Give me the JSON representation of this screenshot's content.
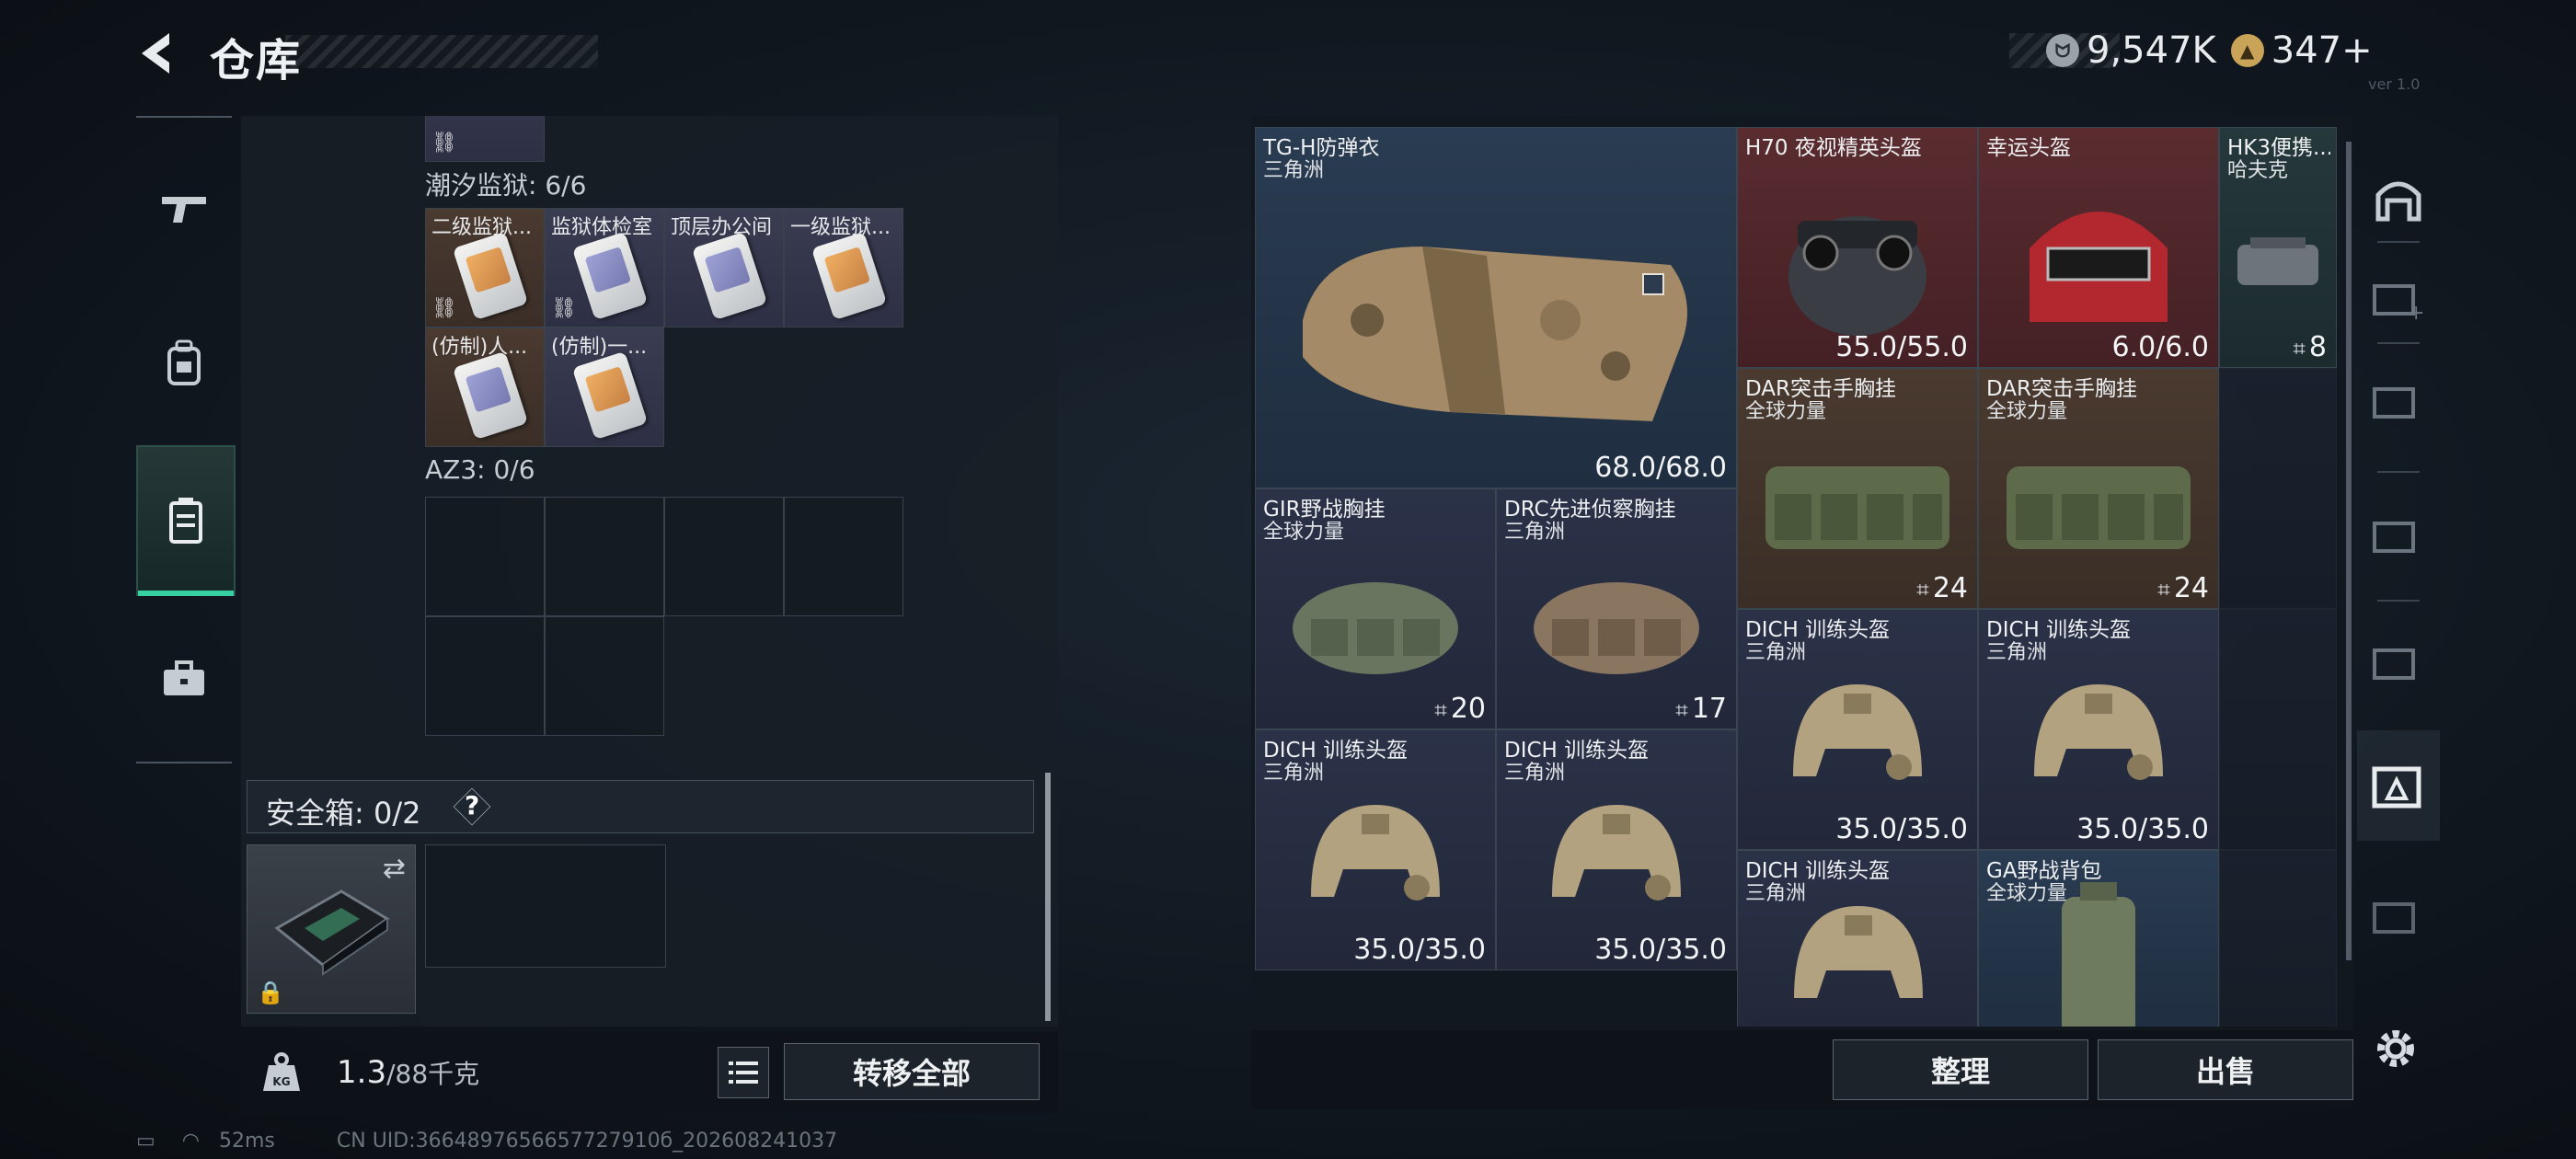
{
  "header": {
    "title": "仓库",
    "currency": [
      {
        "icon": "silver-coin-icon",
        "value": "9,547K"
      },
      {
        "icon": "gold-triangle-coin-icon",
        "value": "347+"
      }
    ],
    "version_text": "ver 1.0"
  },
  "left_nav": {
    "items": [
      {
        "icon": "gun-icon",
        "active": false
      },
      {
        "icon": "backpack-icon",
        "active": false
      },
      {
        "icon": "storage-case-icon",
        "active": true
      },
      {
        "icon": "briefcase-icon",
        "active": false
      }
    ]
  },
  "backpack": {
    "groups": [
      {
        "title": "潮汐监狱: 6/6",
        "items": [
          "二级监狱...",
          "监狱体检室",
          "顶层办公间",
          "一级监狱...",
          "(仿制)人...",
          "(仿制)一..."
        ]
      },
      {
        "title": "AZ3: 0/6"
      }
    ],
    "safe_box": {
      "label": "安全箱: 0/2",
      "help": "?"
    },
    "weight": {
      "current": "1.3",
      "max": "/88千克"
    },
    "transfer_all": "转移全部"
  },
  "stash": {
    "items": [
      {
        "name": "TG-H防弹衣",
        "brand": "三角洲",
        "value": "68.0/68.0",
        "color": "blue"
      },
      {
        "name": "H70 夜视精英头盔",
        "brand": "",
        "value": "55.0/55.0",
        "color": "red"
      },
      {
        "name": "幸运头盔",
        "brand": "",
        "value": "6.0/6.0",
        "color": "red"
      },
      {
        "name": "HK3便携...",
        "brand": "哈夫克",
        "value": "8",
        "color": "teal"
      },
      {
        "name": "DAR突击手胸挂",
        "brand": "全球力量",
        "value": "24",
        "color": "brown"
      },
      {
        "name": "DAR突击手胸挂",
        "brand": "全球力量",
        "value": "24",
        "color": "brown"
      },
      {
        "name": "GIR野战胸挂",
        "brand": "全球力量",
        "value": "20",
        "color": "slate"
      },
      {
        "name": "DRC先进侦察胸挂",
        "brand": "三角洲",
        "value": "17",
        "color": "slate"
      },
      {
        "name": "DICH 训练头盔",
        "brand": "三角洲",
        "value": "35.0/35.0",
        "color": "slate"
      },
      {
        "name": "DICH 训练头盔",
        "brand": "三角洲",
        "value": "35.0/35.0",
        "color": "slate"
      },
      {
        "name": "DICH 训练头盔",
        "brand": "三角洲",
        "value": "35.0/35.0",
        "color": "slate"
      },
      {
        "name": "DICH 训练头盔",
        "brand": "三角洲",
        "value": "35.0/35.0",
        "color": "slate"
      },
      {
        "name": "DICH 训练头盔",
        "brand": "三角洲",
        "value": "",
        "color": "slate"
      },
      {
        "name": "GA野战背包",
        "brand": "全球力量",
        "value": "",
        "color": "blue"
      }
    ],
    "sort": "整理",
    "sell": "出售"
  },
  "status": {
    "ping": "52ms",
    "uid": "CN UID:3664897656657727910б_202608241037"
  }
}
